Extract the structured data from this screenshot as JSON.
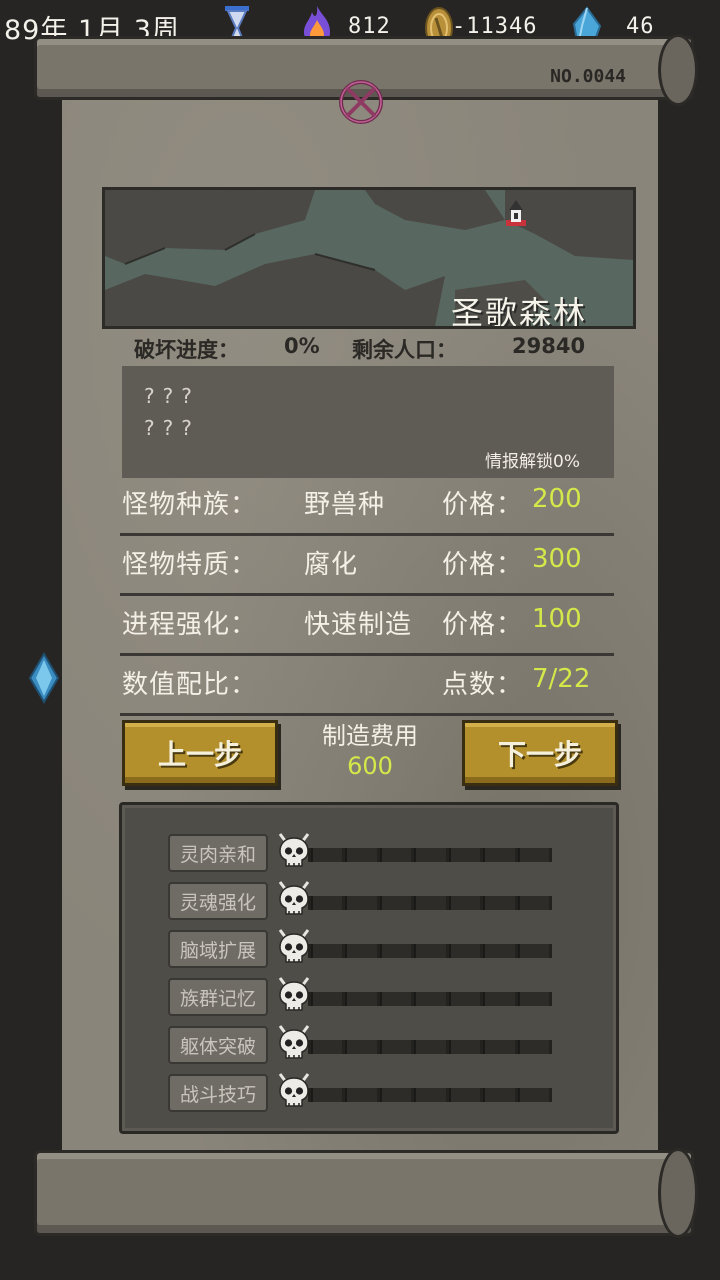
{
  "status_bar": {
    "date": "89年 1月 3周",
    "fire": "812",
    "gold": "-11346",
    "crystal": "46"
  },
  "serial": "NO.0044",
  "map": {
    "name": "圣歌森林"
  },
  "info": {
    "destroy_label": "破坏进度：",
    "destroy_value": "0%",
    "population_label": "剩余人口：",
    "population_value": "29840"
  },
  "intel": {
    "line1": "???",
    "line2": "???",
    "unlock": "情报解锁0%"
  },
  "attributes": [
    {
      "label": "怪物种族：",
      "value": "野兽种",
      "price_label": "价格：",
      "price": "200"
    },
    {
      "label": "怪物特质：",
      "value": "腐化",
      "price_label": "价格：",
      "price": "300"
    },
    {
      "label": "进程强化：",
      "value": "快速制造",
      "price_label": "价格：",
      "price": "100"
    }
  ],
  "ratio": {
    "label": "数值配比：",
    "points_label": "点数：",
    "points": "7/22"
  },
  "buttons": {
    "prev": "上一步",
    "next": "下一步"
  },
  "cost": {
    "label": "制造费用",
    "value": "600"
  },
  "stats": [
    {
      "name": "灵肉亲和",
      "level": 0,
      "max": 7
    },
    {
      "name": "灵魂强化",
      "level": 0,
      "max": 7
    },
    {
      "name": "脑域扩展",
      "level": 0,
      "max": 7
    },
    {
      "name": "族群记忆",
      "level": 0,
      "max": 7
    },
    {
      "name": "躯体突破",
      "level": 0,
      "max": 7
    },
    {
      "name": "战斗技巧",
      "level": 0,
      "max": 7
    }
  ]
}
